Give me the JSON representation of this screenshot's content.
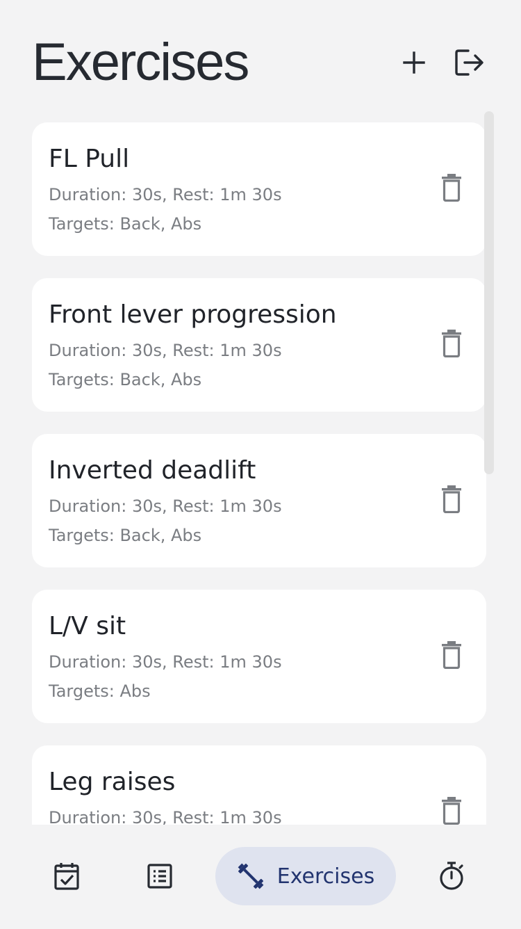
{
  "header": {
    "title": "Exercises",
    "add_icon": "plus-icon",
    "logout_icon": "logout-icon"
  },
  "exercises": [
    {
      "name": "FL Pull",
      "details": "Duration: 30s, Rest: 1m 30s",
      "targets": "Targets: Back, Abs"
    },
    {
      "name": "Front lever progression",
      "details": "Duration: 30s, Rest: 1m 30s",
      "targets": "Targets: Back, Abs"
    },
    {
      "name": "Inverted deadlift",
      "details": "Duration: 30s, Rest: 1m 30s",
      "targets": "Targets: Back, Abs"
    },
    {
      "name": "L/V sit",
      "details": "Duration: 30s, Rest: 1m 30s",
      "targets": "Targets: Abs"
    },
    {
      "name": "Leg raises",
      "details": "Duration: 30s, Rest: 1m 30s",
      "targets": ""
    }
  ],
  "nav": {
    "items": [
      {
        "icon": "calendar-check-icon",
        "label": ""
      },
      {
        "icon": "list-icon",
        "label": ""
      },
      {
        "icon": "dumbbell-icon",
        "label": "Exercises",
        "active": true
      },
      {
        "icon": "timer-icon",
        "label": ""
      }
    ]
  },
  "colors": {
    "background": "#f3f3f4",
    "card": "#ffffff",
    "active_nav_bg": "#dfe3ef",
    "active_nav_fg": "#22346f",
    "icon": "#262a31",
    "delete_icon": "#7a7d82"
  }
}
